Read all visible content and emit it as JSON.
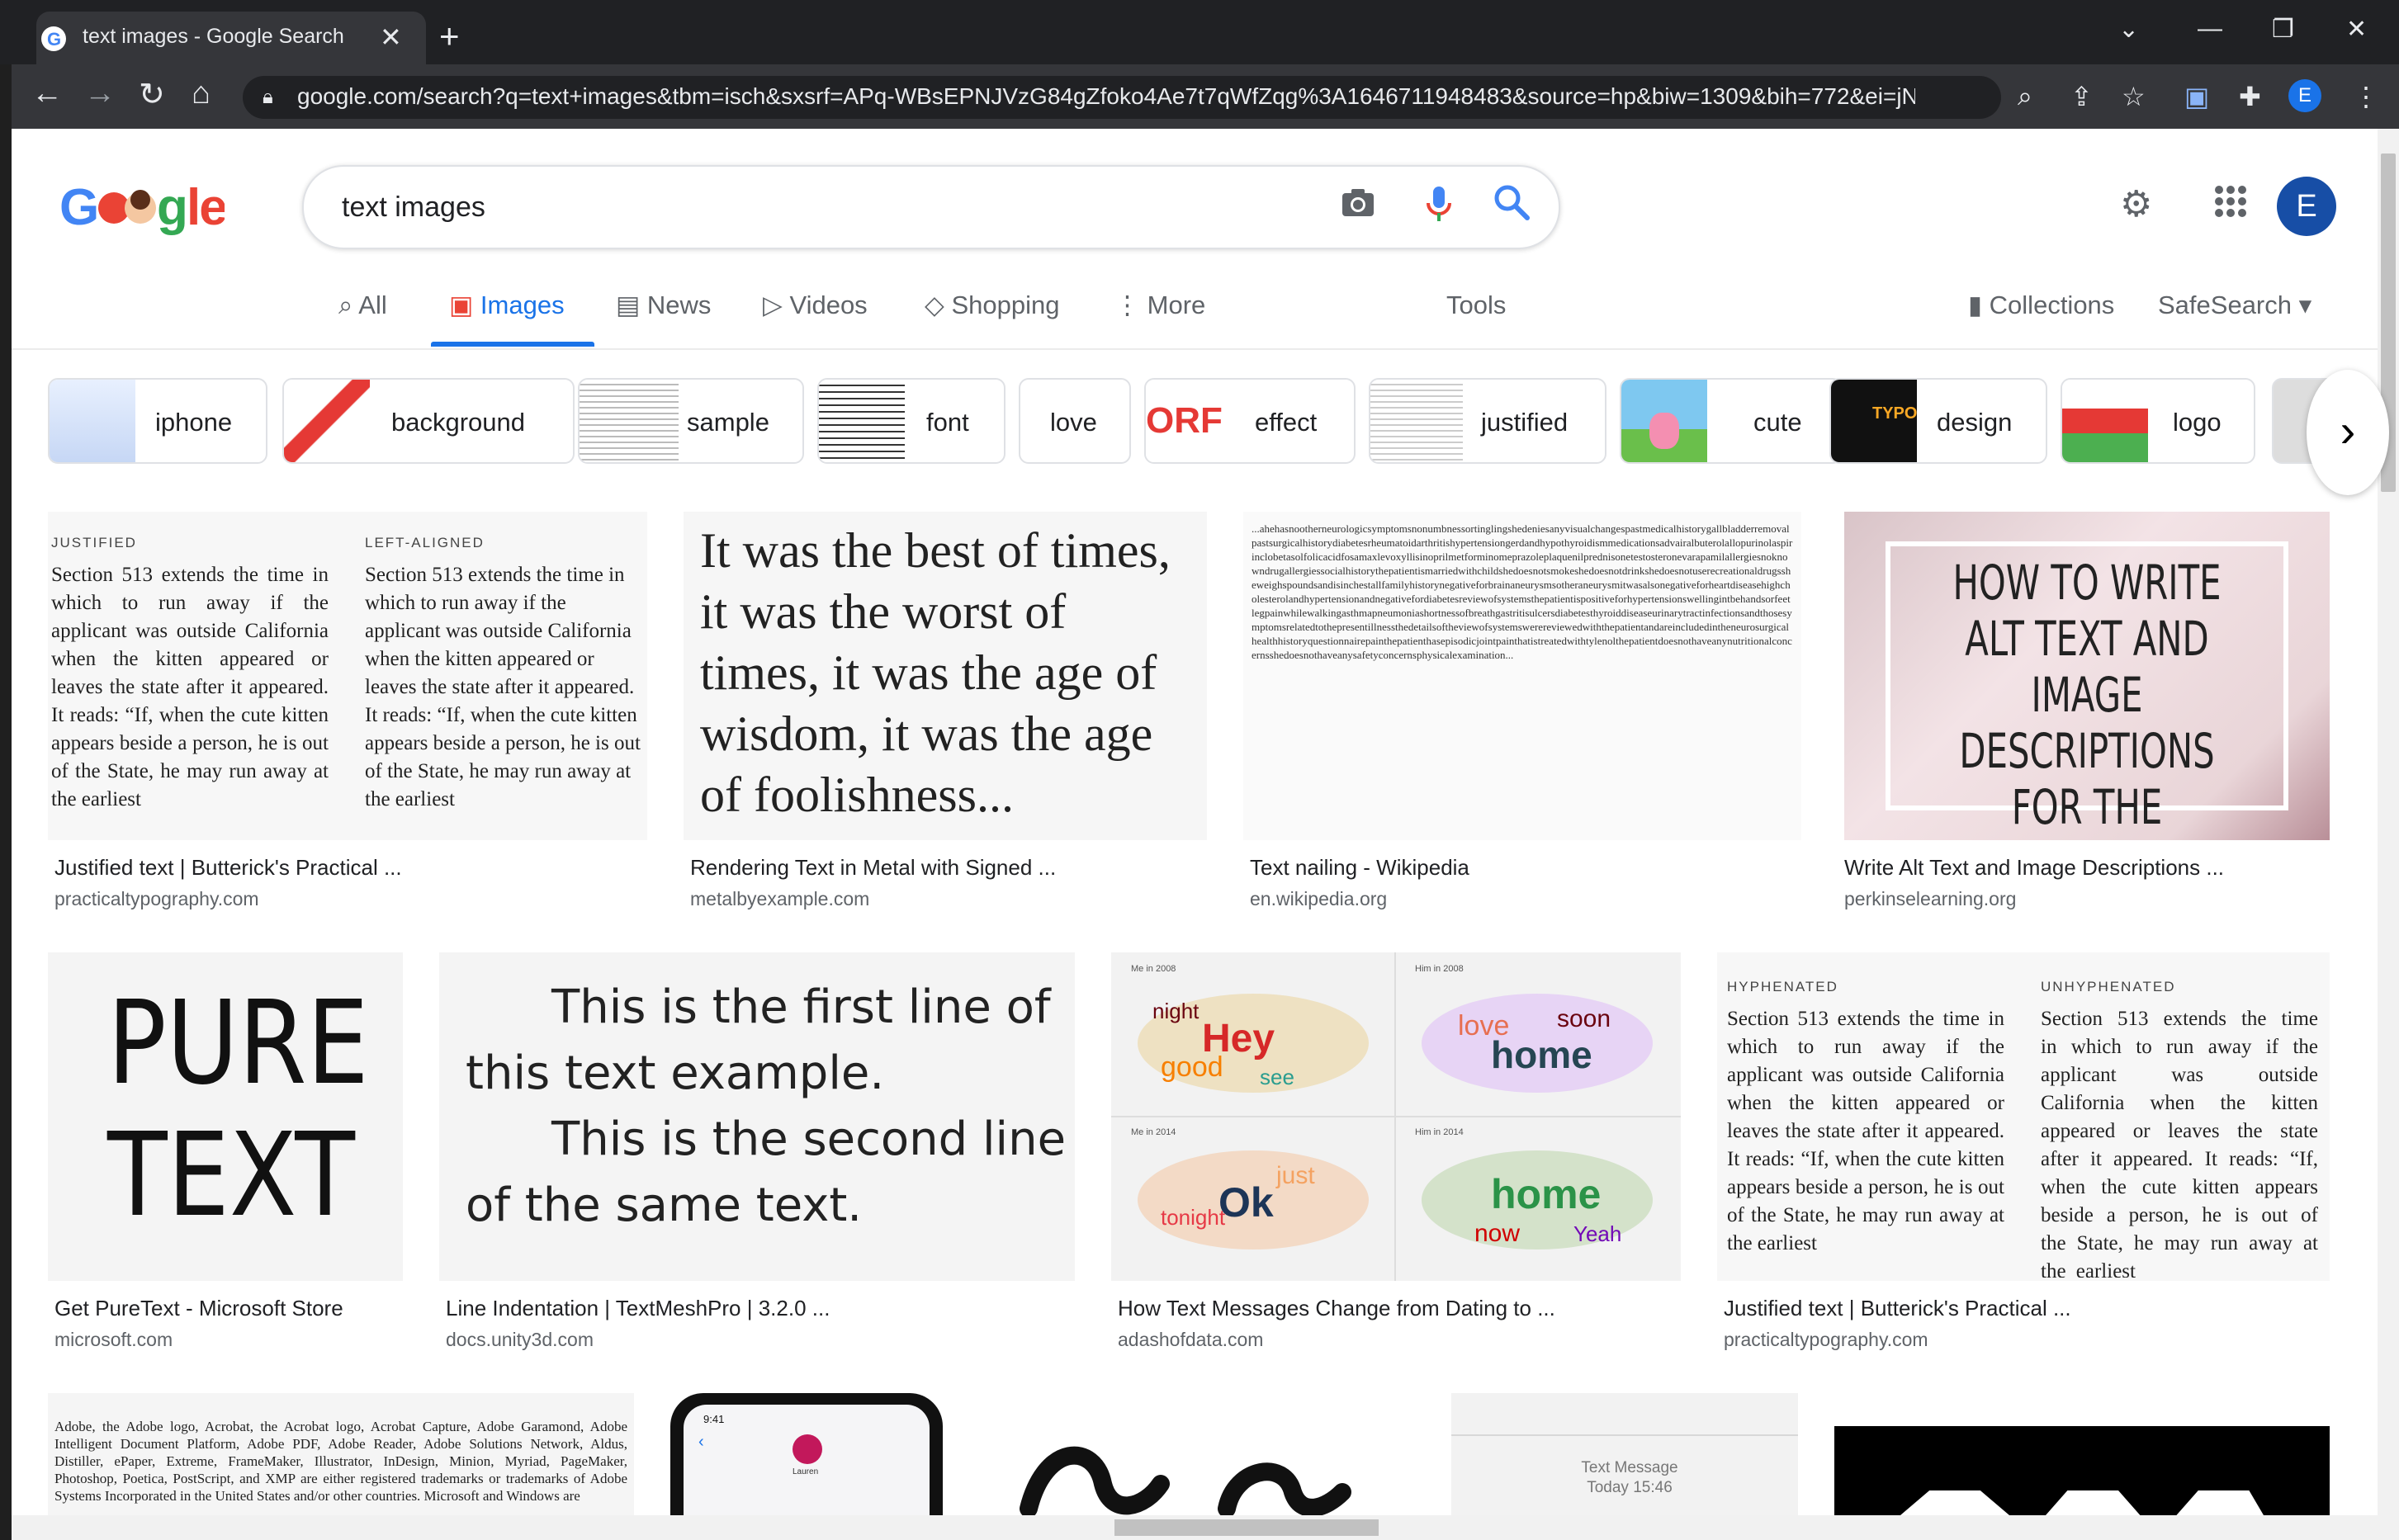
{
  "browser": {
    "tab_title": "text images - Google Search",
    "url": "google.com/search?q=text+images&tbm=isch&sxsrf=APq-WBsEPNJVzG84gZfoko4Ae7t7qWfZqg%3A1646711948483&source=hp&biw=1309&bih=772&ei=jNQm...",
    "profile_initial": "E"
  },
  "search": {
    "query": "text images",
    "logo_text": "Google"
  },
  "header": {
    "user_initial": "E"
  },
  "nav": {
    "tabs": [
      {
        "label": "All"
      },
      {
        "label": "Images"
      },
      {
        "label": "News"
      },
      {
        "label": "Videos"
      },
      {
        "label": "Shopping"
      },
      {
        "label": "More"
      }
    ],
    "tools": "Tools",
    "collections": "Collections",
    "safesearch": "SafeSearch"
  },
  "chips": [
    "iphone",
    "background",
    "sample",
    "font",
    "love",
    "effect",
    "justified",
    "cute",
    "design",
    "logo"
  ],
  "results": [
    {
      "title": "Justified text | Butterick's Practical ...",
      "source": "practicaltypography.com"
    },
    {
      "title": "Rendering Text in Metal with Signed ...",
      "source": "metalbyexample.com"
    },
    {
      "title": "Text nailing - Wikipedia",
      "source": "en.wikipedia.org"
    },
    {
      "title": "Write Alt Text and Image Descriptions ...",
      "source": "perkinselearning.org"
    },
    {
      "title": "Get PureText - Microsoft Store",
      "source": "microsoft.com"
    },
    {
      "title": "Line Indentation | TextMeshPro | 3.2.0 ...",
      "source": "docs.unity3d.com"
    },
    {
      "title": "How Text Messages Change from Dating to ...",
      "source": "adashofdata.com"
    },
    {
      "title": "Justified text | Butterick's Practical ...",
      "source": "practicaltypography.com"
    }
  ],
  "images": {
    "justified": {
      "label_left": "JUSTIFIED",
      "label_right": "LEFT-ALIGNED",
      "body": "Section 513 extends the time in which to run away if the applicant was outside California when the kitten appeared or leaves the state after it appeared. It reads: “If, when the cute kitten appears beside a person, he is out of the State, he may run away at the earliest"
    },
    "dickens": "It was the best of times, it was the worst of times, it was the age of wisdom, it was the age of foolishness...",
    "nailing": "...ahehasnootherneurologicsymptomsnonumbnessortinglingshedeniesanyvisualchangespastmedicalhistorygallbladderremovalpastsurgicalhistorydiabetesrheumatoidarthritishypertensiongerdandhypothyroidismmedicationsadvairalbuterolallopurinolaspirinclobetasolfolicacidfosamaxlevoxyllisinoprilmetforminomeprazoleplaquenilprednisonetestosteronevarapamilallergiesnoknowndrugallergiessocialhistorythepatientismarriedwithchildshedoesnotsmokeshedoesnotdrinkshedoesnotuserecreationaldrugssheweighspoundsandisinchestallfamilyhistorynegativeforbrainaneurysmsotheraneurysmitwasalsonegativeforheartdiseasehighcholesterolandhypertensionandnegativefordiabetesreviewofsystemsthepatientispositiveforhypertensionswellingintbehandsorfeetlegpainwhilewalkingasthmapneumoniashortnessofbreathgastritisulcersdiabetesthyroiddiseaseurinarytractinfectionsandthosesymptomsrelatedtothepresentillnessthedetailsoftheviewofsystemswerereviewedwiththepatientandareincludedintheneurosurgicalhealthhistoryquestionnairepainthepatienthasepisodicjointpainthatistreatedwithtylenolthepatientdoesnothaveanynutritionalconcernsshedoesnothaveanysafetyconcernsphysicalexamination...",
    "alttext": "HOW TO WRITE ALT TEXT AND IMAGE DESCRIPTIONS FOR THE VISUALLY IMPAIRED",
    "puretext_line1": "PURE",
    "puretext_line2": "TEXT",
    "indent_lines": [
      "This is the first line of",
      "this text example.",
      "This is the second line",
      "of the same text."
    ],
    "wordcloud_labels": [
      "Me in 2008",
      "Him in 2008",
      "Me in 2014",
      "Him in 2014"
    ],
    "hyphen": {
      "label_left": "HYPHENATED",
      "label_right": "UNHYPHENATED"
    },
    "adobe": "Adobe, the Adobe logo, Acrobat, the Acrobat logo, Acrobat Capture, Adobe Garamond, Adobe Intelligent Document Platform, Adobe PDF, Adobe Reader, Adobe Solutions Network, Aldus, Distiller, ePaper, Extreme, FrameMaker, Illustrator, InDesign, Minion, Myriad, PageMaker, Photoshop, Poetica, PostScript, and XMP are either registered trademarks or trademarks of Adobe Systems Incorporated in the United States and/or other countries. Microsoft and Windows are",
    "phone_time": "9:41",
    "phone_name": "Lauren",
    "text_message_label": "Text Message",
    "text_message_time": "Today 15:46"
  }
}
